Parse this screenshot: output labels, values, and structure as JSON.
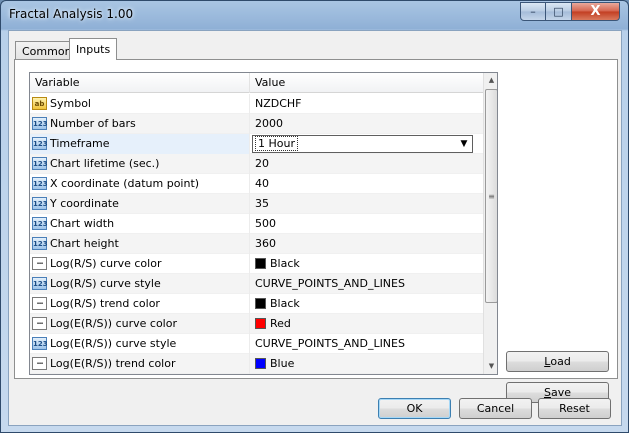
{
  "window": {
    "title": "Fractal Analysis 1.00"
  },
  "titlebar_buttons": {
    "minimize": "–",
    "maximize": "□",
    "close": "X"
  },
  "tabs": [
    {
      "label": "Common",
      "active": false
    },
    {
      "label": "Inputs",
      "active": true
    }
  ],
  "grid": {
    "headers": {
      "variable": "Variable",
      "value": "Value"
    },
    "rows": [
      {
        "icon": "string-icon",
        "icon_text": "ab",
        "variable": "Symbol",
        "value": "NZDCHF"
      },
      {
        "icon": "number-icon",
        "icon_text": "123",
        "variable": "Number of bars",
        "value": "2000"
      },
      {
        "icon": "number-icon",
        "icon_text": "123",
        "variable": "Timeframe",
        "value": "1 Hour",
        "editing": true
      },
      {
        "icon": "number-icon",
        "icon_text": "123",
        "variable": "Chart lifetime (sec.)",
        "value": "20"
      },
      {
        "icon": "number-icon",
        "icon_text": "123",
        "variable": "X coordinate (datum point)",
        "value": "40"
      },
      {
        "icon": "number-icon",
        "icon_text": "123",
        "variable": "Y coordinate",
        "value": "35"
      },
      {
        "icon": "number-icon",
        "icon_text": "123",
        "variable": "Chart width",
        "value": "500"
      },
      {
        "icon": "number-icon",
        "icon_text": "123",
        "variable": "Chart height",
        "value": "360"
      },
      {
        "icon": "enum-icon",
        "icon_text": "···",
        "variable": "Log(R/S) curve color",
        "value": "Black",
        "color": "#000000"
      },
      {
        "icon": "number-icon",
        "icon_text": "123",
        "variable": "Log(R/S) curve style",
        "value": "CURVE_POINTS_AND_LINES"
      },
      {
        "icon": "enum-icon",
        "icon_text": "···",
        "variable": "Log(R/S) trend color",
        "value": "Black",
        "color": "#000000"
      },
      {
        "icon": "enum-icon",
        "icon_text": "···",
        "variable": "Log(E(R/S)) curve color",
        "value": "Red",
        "color": "#ff0000"
      },
      {
        "icon": "number-icon",
        "icon_text": "123",
        "variable": "Log(E(R/S)) curve style",
        "value": "CURVE_POINTS_AND_LINES"
      },
      {
        "icon": "enum-icon",
        "icon_text": "···",
        "variable": "Log(E(R/S)) trend color",
        "value": "Blue",
        "color": "#0000ff"
      }
    ]
  },
  "buttons": {
    "load": {
      "mnemonic": "L",
      "rest": "oad"
    },
    "save": {
      "mnemonic": "S",
      "rest": "ave"
    },
    "ok": "OK",
    "cancel": "Cancel",
    "reset": "Reset"
  }
}
